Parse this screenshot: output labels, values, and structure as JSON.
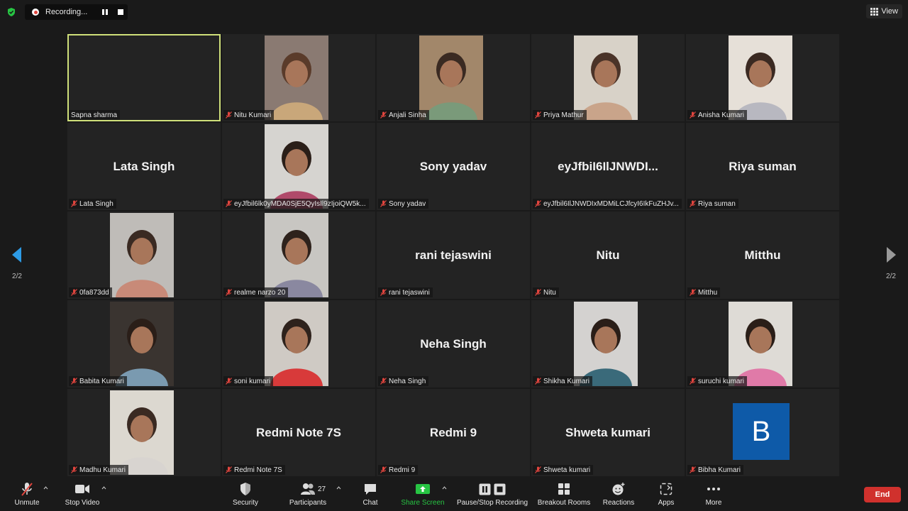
{
  "recording": {
    "label": "Recording..."
  },
  "view_button": {
    "label": "View"
  },
  "pager": {
    "left": "2/2",
    "right": "2/2"
  },
  "participants": [
    {
      "name": "Sapna sharma",
      "display": "",
      "type": "blank",
      "active": true,
      "muted": false
    },
    {
      "name": "Nitu Kumari",
      "type": "video",
      "muted": true
    },
    {
      "name": "Anjali Sinha",
      "type": "video",
      "muted": true
    },
    {
      "name": "Priya Mathur",
      "type": "video",
      "muted": true
    },
    {
      "name": "Anisha Kumari",
      "type": "video",
      "muted": true
    },
    {
      "name": "Lata Singh",
      "display": "Lata Singh",
      "type": "name",
      "muted": true
    },
    {
      "name": "eyJfbil6lk0yMDA0SjE5QyIsIl9zIjoiQW5k...",
      "type": "video",
      "muted": true
    },
    {
      "name": "Sony yadav",
      "display": "Sony yadav",
      "type": "name",
      "muted": true
    },
    {
      "name": "eyJfbil6IlJNWDIxMDMiLCJfcyI6IkFuZHJv...",
      "display": "eyJfbiI6IlJNWDI...",
      "type": "name",
      "muted": true
    },
    {
      "name": "Riya suman",
      "display": "Riya suman",
      "type": "name",
      "muted": true
    },
    {
      "name": "0fa873dd",
      "type": "video",
      "muted": true
    },
    {
      "name": "realme narzo 20",
      "type": "video",
      "muted": true
    },
    {
      "name": "rani tejaswini",
      "display": "rani tejaswini",
      "type": "name",
      "muted": true
    },
    {
      "name": "Nitu",
      "display": "Nitu",
      "type": "name",
      "muted": true
    },
    {
      "name": "Mitthu",
      "display": "Mitthu",
      "type": "name",
      "muted": true
    },
    {
      "name": "Babita Kumari",
      "type": "video",
      "muted": true
    },
    {
      "name": "soni kumari",
      "type": "video",
      "muted": true
    },
    {
      "name": "Neha Singh",
      "display": "Neha Singh",
      "type": "name",
      "muted": true
    },
    {
      "name": "Shikha Kumari",
      "type": "video",
      "muted": true
    },
    {
      "name": "suruchi kumari",
      "type": "video",
      "muted": true
    },
    {
      "name": "Madhu Kumari",
      "type": "video",
      "muted": true
    },
    {
      "name": "Redmi Note 7S",
      "display": "Redmi Note 7S",
      "type": "name",
      "muted": true
    },
    {
      "name": "Redmi 9",
      "display": "Redmi 9",
      "type": "name",
      "muted": true
    },
    {
      "name": "Shweta kumari",
      "display": "Shweta kumari",
      "type": "name",
      "muted": true
    },
    {
      "name": "Bibha Kumari",
      "display": "B",
      "type": "avatar",
      "muted": true
    }
  ],
  "toolbar": {
    "unmute": "Unmute",
    "stop_video": "Stop Video",
    "security": "Security",
    "participants": "Participants",
    "participant_count": "27",
    "chat": "Chat",
    "share_screen": "Share Screen",
    "pause_stop_recording": "Pause/Stop Recording",
    "breakout_rooms": "Breakout Rooms",
    "reactions": "Reactions",
    "apps": "Apps",
    "more": "More",
    "end": "End"
  },
  "colors": {
    "background": "#1a1a1a",
    "tile": "#232323",
    "active_speaker": "#cfe07a",
    "share_green": "#27c443",
    "end_red": "#d0312d",
    "avatar_blue": "#0e5aa8",
    "pager_arrow": "#2d9be6"
  }
}
